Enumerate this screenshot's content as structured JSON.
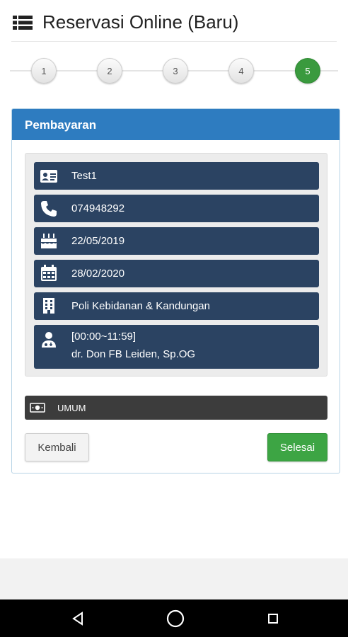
{
  "header": {
    "title": "Reservasi Online (Baru)",
    "icon": "list-menu-icon"
  },
  "stepper": {
    "steps": [
      "1",
      "2",
      "3",
      "4",
      "5"
    ],
    "active_step": "5",
    "active_color": "#3a9a3e"
  },
  "panel": {
    "heading": "Pembayaran",
    "heading_color": "#2e7cc0"
  },
  "info": {
    "name": {
      "icon": "id-card-icon",
      "value": "Test1"
    },
    "phone": {
      "icon": "phone-icon",
      "value": "074948292"
    },
    "birth_date": {
      "icon": "birthday-cake-icon",
      "value": "22/05/2019"
    },
    "visit_date": {
      "icon": "calendar-icon",
      "value": "28/02/2020"
    },
    "clinic": {
      "icon": "building-icon",
      "value": "Poli Kebidanan & Kandungan"
    },
    "doctor": {
      "icon": "doctor-icon",
      "time": "[00:00~11:59]",
      "name": "dr. Don FB Leiden, Sp.OG"
    },
    "row_color": "#2b4362"
  },
  "payment": {
    "icon": "money-icon",
    "label": "UMUM"
  },
  "buttons": {
    "back_label": "Kembali",
    "done_label": "Selesai",
    "done_color": "#3da544"
  },
  "android_nav": {
    "back": "nav-back-icon",
    "home": "nav-home-icon",
    "recents": "nav-recents-icon"
  }
}
